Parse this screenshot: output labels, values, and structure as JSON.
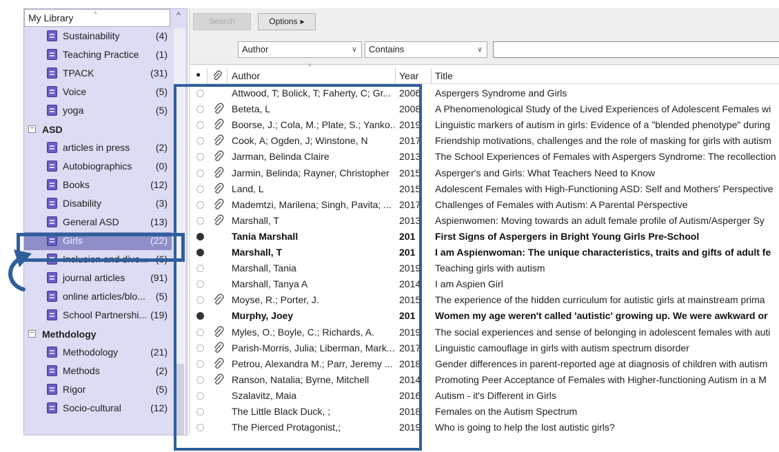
{
  "library": {
    "header": "My Library",
    "items": [
      {
        "kind": "group",
        "label": "Sustainability",
        "count": "(4)"
      },
      {
        "kind": "group",
        "label": "Teaching Practice",
        "count": "(1)"
      },
      {
        "kind": "group",
        "label": "TPACK",
        "count": "(31)"
      },
      {
        "kind": "group",
        "label": "Voice",
        "count": "(5)"
      },
      {
        "kind": "group",
        "label": "yoga",
        "count": "(5)"
      },
      {
        "kind": "set",
        "label": "ASD",
        "toggle": "⊟"
      },
      {
        "kind": "group",
        "label": "articles in press",
        "count": "(2)"
      },
      {
        "kind": "group",
        "label": "Autobiographics",
        "count": "(0)"
      },
      {
        "kind": "group",
        "label": "Books",
        "count": "(12)"
      },
      {
        "kind": "group",
        "label": "Disability",
        "count": "(3)"
      },
      {
        "kind": "group",
        "label": "General ASD",
        "count": "(13)"
      },
      {
        "kind": "group",
        "label": "Girls",
        "count": "(22)",
        "selected": true
      },
      {
        "kind": "group",
        "label": "Inclusion and dive...",
        "count": "(6)"
      },
      {
        "kind": "group",
        "label": "journal articles",
        "count": "(91)"
      },
      {
        "kind": "group",
        "label": "online articles/blo...",
        "count": "(5)"
      },
      {
        "kind": "group",
        "label": "School Partnershi...",
        "count": "(19)"
      },
      {
        "kind": "set",
        "label": "Methdology",
        "toggle": "⊟"
      },
      {
        "kind": "group",
        "label": "Methodology",
        "count": "(21)"
      },
      {
        "kind": "group",
        "label": "Methods",
        "count": "(2)"
      },
      {
        "kind": "group",
        "label": "Rigor",
        "count": "(5)"
      },
      {
        "kind": "group",
        "label": "Socio-cultural",
        "count": "(12)"
      }
    ]
  },
  "toolbar": {
    "search_label": "Search",
    "options_label": "Options",
    "field_value": "Author",
    "operator_value": "Contains",
    "search_value": ""
  },
  "table": {
    "columns": {
      "author": "Author",
      "year": "Year",
      "title": "Title"
    },
    "rows": [
      {
        "author": "Attwood, T; Bolick, T; Faherty, C; Gr...",
        "year": "2006",
        "title": "Aspergers Syndrome and Girls",
        "attachment": false,
        "unread": false
      },
      {
        "author": "Beteta, L",
        "year": "2008",
        "title": "A Phenomenological Study of the Lived Experiences of Adolescent Females wi",
        "attachment": true,
        "unread": false
      },
      {
        "author": "Boorse, J.; Cola, M.; Plate, S.; Yanko...",
        "year": "2019",
        "title": "Linguistic markers of autism in girls: Evidence of a \"blended phenotype\" during",
        "attachment": true,
        "unread": false
      },
      {
        "author": "Cook, A; Ogden, J; Winstone, N",
        "year": "2017",
        "title": "Friendship motivations, challenges and the role of masking for girls with autism",
        "attachment": true,
        "unread": false
      },
      {
        "author": "Jarman, Belinda Claire",
        "year": "2013",
        "title": "The School Experiences of Females with Aspergers Syndrome: The recollection",
        "attachment": true,
        "unread": false
      },
      {
        "author": "Jarmin, Belinda; Rayner, Christopher",
        "year": "2015",
        "title": "Asperger's and Girls: What Teachers Need to Know",
        "attachment": true,
        "unread": false
      },
      {
        "author": "Land, L",
        "year": "2015",
        "title": "Adolescent Females with High-Functioning ASD: Self and Mothers' Perspective",
        "attachment": true,
        "unread": false
      },
      {
        "author": "Mademtzi, Marilena; Singh, Pavita; ...",
        "year": "2017",
        "title": "Challenges of Females with Autism: A Parental Perspective",
        "attachment": true,
        "unread": false
      },
      {
        "author": "Marshall, T",
        "year": "2013",
        "title": "Aspienwomen: Moving towards an adult female profile of Autism/Asperger Sy",
        "attachment": true,
        "unread": false
      },
      {
        "author": "Tania Marshall",
        "year": "201",
        "title": "First Signs of Aspergers in Bright Young Girls Pre-School",
        "attachment": false,
        "unread": true
      },
      {
        "author": "Marshall, T",
        "year": "201",
        "title": "I am Aspienwoman: The unique characteristics, traits and gifts of adult fe",
        "attachment": false,
        "unread": true
      },
      {
        "author": "Marshall, Tania",
        "year": "2019",
        "title": "Teaching girls with autism",
        "attachment": false,
        "unread": false
      },
      {
        "author": "Marshall, Tanya A",
        "year": "2014",
        "title": "I am Aspien Girl",
        "attachment": false,
        "unread": false
      },
      {
        "author": "Moyse, R.; Porter, J.",
        "year": "2015",
        "title": "The experience of the hidden curriculum for autistic girls at mainstream prima",
        "attachment": true,
        "unread": false
      },
      {
        "author": "Murphy, Joey",
        "year": "201",
        "title": "Women my age weren't called 'autistic' growing up. We were awkward or",
        "attachment": false,
        "unread": true
      },
      {
        "author": "Myles, O.; Boyle, C.; Richards, A.",
        "year": "2019",
        "title": "The social experiences and sense of belonging in adolescent females with auti",
        "attachment": true,
        "unread": false
      },
      {
        "author": "Parish-Morris, Julia; Liberman, Mark...",
        "year": "2017",
        "title": "Linguistic camouflage in girls with autism spectrum disorder",
        "attachment": true,
        "unread": false
      },
      {
        "author": "Petrou, Alexandra M.; Parr, Jeremy ...",
        "year": "2018",
        "title": "Gender differences in parent-reported age at diagnosis of children with autism",
        "attachment": true,
        "unread": false
      },
      {
        "author": "Ranson, Natalia; Byrne, Mitchell",
        "year": "2014",
        "title": "Promoting Peer Acceptance of Females with Higher-functioning Autism in a M",
        "attachment": true,
        "unread": false
      },
      {
        "author": "Szalavitz, Maia",
        "year": "2016",
        "title": "Autism - it's Different in Girls",
        "attachment": false,
        "unread": false
      },
      {
        "author": "The Little Black Duck, ;",
        "year": "2018",
        "title": "Females on the Autism Spectrum",
        "attachment": false,
        "unread": false
      },
      {
        "author": "The Pierced Protagonist,;",
        "year": "2019",
        "title": "Who is going to help the lost autistic girls?",
        "attachment": false,
        "unread": false
      }
    ]
  },
  "colors": {
    "highlight_box": "#2f5f9c",
    "selected_row": "#8e8ec8",
    "group_icon": "#6a5ec4",
    "library_bg": "#dcdcf5"
  },
  "icons": {
    "group": "group-folder-icon",
    "attachment": "paperclip-icon",
    "read_status": "read-status-dot-icon"
  }
}
